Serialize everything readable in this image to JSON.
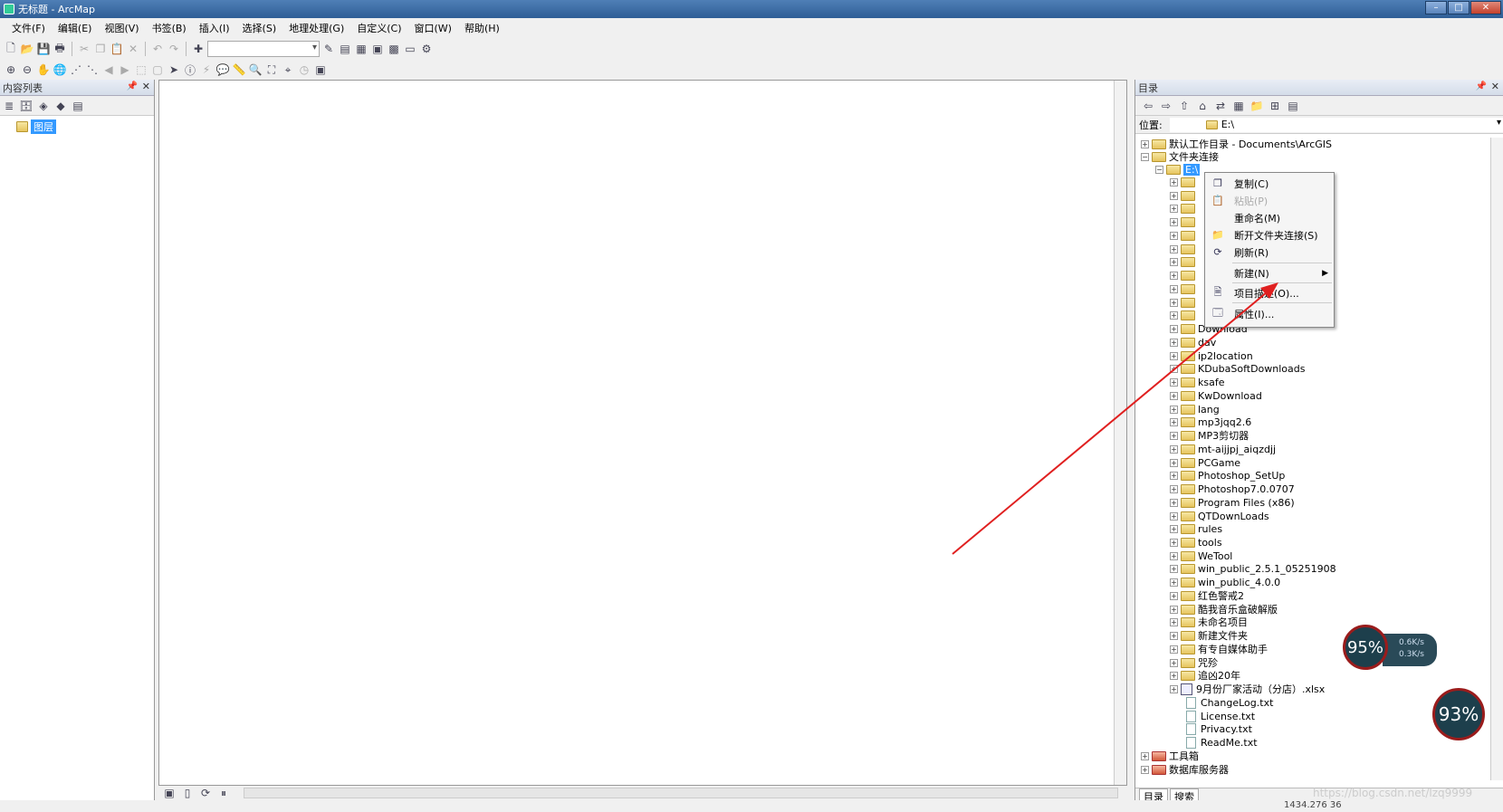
{
  "window": {
    "title": "无标题 - ArcMap"
  },
  "menu": [
    "文件(F)",
    "编辑(E)",
    "视图(V)",
    "书签(B)",
    "插入(I)",
    "选择(S)",
    "地理处理(G)",
    "自定义(C)",
    "窗口(W)",
    "帮助(H)"
  ],
  "toc": {
    "title": "内容列表",
    "layers_label": "图层"
  },
  "catalog": {
    "title": "目录",
    "location_label": "位置:",
    "location_value": "E:\\",
    "tree": {
      "default_workdir": "默认工作目录 - Documents\\ArcGIS",
      "folder_connections": "文件夹连接",
      "drive": "E:\\",
      "items": [
        "Download",
        "dav",
        "ip2location",
        "KDubaSoftDownloads",
        "ksafe",
        "KwDownload",
        "lang",
        "mp3jqq2.6",
        "MP3剪切器",
        "mt-aijjpj_aiqzdjj",
        "PCGame",
        "Photoshop_SetUp",
        "Photoshop7.0.0707",
        "Program Files (x86)",
        "QTDownLoads",
        "rules",
        "tools",
        "WeTool",
        "win_public_2.5.1_05251908",
        "win_public_4.0.0",
        "红色警戒2",
        "酷我音乐盒破解版",
        "未命名项目",
        "新建文件夹",
        "有专自媒体助手",
        "咒殄",
        "追凶20年"
      ],
      "xlsx": "9月份厂家活动（分店）.xlsx",
      "files": [
        "ChangeLog.txt",
        "License.txt",
        "Privacy.txt",
        "ReadMe.txt"
      ],
      "toolbox": "工具箱",
      "db_servers": "数据库服务器"
    },
    "tabs": [
      "目录",
      "搜索"
    ]
  },
  "context_menu": {
    "copy": "复制(C)",
    "paste": "粘贴(P)",
    "rename": "重命名(M)",
    "disconnect": "断开文件夹连接(S)",
    "refresh": "刷新(R)",
    "new": "新建(N)",
    "item_desc": "项目描述(O)...",
    "properties": "属性(I)..."
  },
  "status": {
    "coords": "1434.276  36"
  },
  "widgets": {
    "gauge1": "95%",
    "gauge2": "93%",
    "up": "0.6K/s",
    "down": "0.3K/s"
  },
  "watermark": "https://blog.csdn.net/lzq9999",
  "colors": {
    "selection": "#3399ff",
    "annotation_arrow": "#e02020",
    "titlebar": "#3f6fa8"
  }
}
